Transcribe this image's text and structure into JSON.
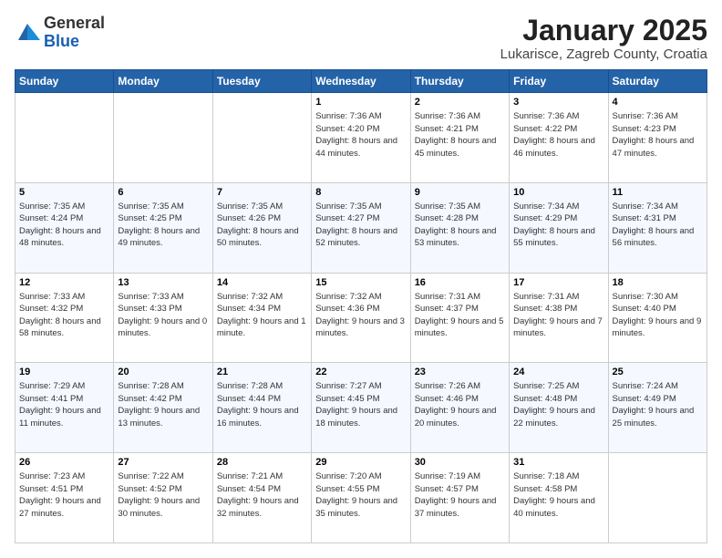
{
  "logo": {
    "general": "General",
    "blue": "Blue"
  },
  "header": {
    "title": "January 2025",
    "subtitle": "Lukarisce, Zagreb County, Croatia"
  },
  "weekdays": [
    "Sunday",
    "Monday",
    "Tuesday",
    "Wednesday",
    "Thursday",
    "Friday",
    "Saturday"
  ],
  "weeks": [
    [
      {
        "day": "",
        "info": ""
      },
      {
        "day": "",
        "info": ""
      },
      {
        "day": "",
        "info": ""
      },
      {
        "day": "1",
        "sunrise": "7:36 AM",
        "sunset": "4:20 PM",
        "daylight": "8 hours and 44 minutes."
      },
      {
        "day": "2",
        "sunrise": "7:36 AM",
        "sunset": "4:21 PM",
        "daylight": "8 hours and 45 minutes."
      },
      {
        "day": "3",
        "sunrise": "7:36 AM",
        "sunset": "4:22 PM",
        "daylight": "8 hours and 46 minutes."
      },
      {
        "day": "4",
        "sunrise": "7:36 AM",
        "sunset": "4:23 PM",
        "daylight": "8 hours and 47 minutes."
      }
    ],
    [
      {
        "day": "5",
        "sunrise": "7:35 AM",
        "sunset": "4:24 PM",
        "daylight": "8 hours and 48 minutes."
      },
      {
        "day": "6",
        "sunrise": "7:35 AM",
        "sunset": "4:25 PM",
        "daylight": "8 hours and 49 minutes."
      },
      {
        "day": "7",
        "sunrise": "7:35 AM",
        "sunset": "4:26 PM",
        "daylight": "8 hours and 50 minutes."
      },
      {
        "day": "8",
        "sunrise": "7:35 AM",
        "sunset": "4:27 PM",
        "daylight": "8 hours and 52 minutes."
      },
      {
        "day": "9",
        "sunrise": "7:35 AM",
        "sunset": "4:28 PM",
        "daylight": "8 hours and 53 minutes."
      },
      {
        "day": "10",
        "sunrise": "7:34 AM",
        "sunset": "4:29 PM",
        "daylight": "8 hours and 55 minutes."
      },
      {
        "day": "11",
        "sunrise": "7:34 AM",
        "sunset": "4:31 PM",
        "daylight": "8 hours and 56 minutes."
      }
    ],
    [
      {
        "day": "12",
        "sunrise": "7:33 AM",
        "sunset": "4:32 PM",
        "daylight": "8 hours and 58 minutes."
      },
      {
        "day": "13",
        "sunrise": "7:33 AM",
        "sunset": "4:33 PM",
        "daylight": "9 hours and 0 minutes."
      },
      {
        "day": "14",
        "sunrise": "7:32 AM",
        "sunset": "4:34 PM",
        "daylight": "9 hours and 1 minute."
      },
      {
        "day": "15",
        "sunrise": "7:32 AM",
        "sunset": "4:36 PM",
        "daylight": "9 hours and 3 minutes."
      },
      {
        "day": "16",
        "sunrise": "7:31 AM",
        "sunset": "4:37 PM",
        "daylight": "9 hours and 5 minutes."
      },
      {
        "day": "17",
        "sunrise": "7:31 AM",
        "sunset": "4:38 PM",
        "daylight": "9 hours and 7 minutes."
      },
      {
        "day": "18",
        "sunrise": "7:30 AM",
        "sunset": "4:40 PM",
        "daylight": "9 hours and 9 minutes."
      }
    ],
    [
      {
        "day": "19",
        "sunrise": "7:29 AM",
        "sunset": "4:41 PM",
        "daylight": "9 hours and 11 minutes."
      },
      {
        "day": "20",
        "sunrise": "7:28 AM",
        "sunset": "4:42 PM",
        "daylight": "9 hours and 13 minutes."
      },
      {
        "day": "21",
        "sunrise": "7:28 AM",
        "sunset": "4:44 PM",
        "daylight": "9 hours and 16 minutes."
      },
      {
        "day": "22",
        "sunrise": "7:27 AM",
        "sunset": "4:45 PM",
        "daylight": "9 hours and 18 minutes."
      },
      {
        "day": "23",
        "sunrise": "7:26 AM",
        "sunset": "4:46 PM",
        "daylight": "9 hours and 20 minutes."
      },
      {
        "day": "24",
        "sunrise": "7:25 AM",
        "sunset": "4:48 PM",
        "daylight": "9 hours and 22 minutes."
      },
      {
        "day": "25",
        "sunrise": "7:24 AM",
        "sunset": "4:49 PM",
        "daylight": "9 hours and 25 minutes."
      }
    ],
    [
      {
        "day": "26",
        "sunrise": "7:23 AM",
        "sunset": "4:51 PM",
        "daylight": "9 hours and 27 minutes."
      },
      {
        "day": "27",
        "sunrise": "7:22 AM",
        "sunset": "4:52 PM",
        "daylight": "9 hours and 30 minutes."
      },
      {
        "day": "28",
        "sunrise": "7:21 AM",
        "sunset": "4:54 PM",
        "daylight": "9 hours and 32 minutes."
      },
      {
        "day": "29",
        "sunrise": "7:20 AM",
        "sunset": "4:55 PM",
        "daylight": "9 hours and 35 minutes."
      },
      {
        "day": "30",
        "sunrise": "7:19 AM",
        "sunset": "4:57 PM",
        "daylight": "9 hours and 37 minutes."
      },
      {
        "day": "31",
        "sunrise": "7:18 AM",
        "sunset": "4:58 PM",
        "daylight": "9 hours and 40 minutes."
      },
      {
        "day": "",
        "info": ""
      }
    ]
  ]
}
